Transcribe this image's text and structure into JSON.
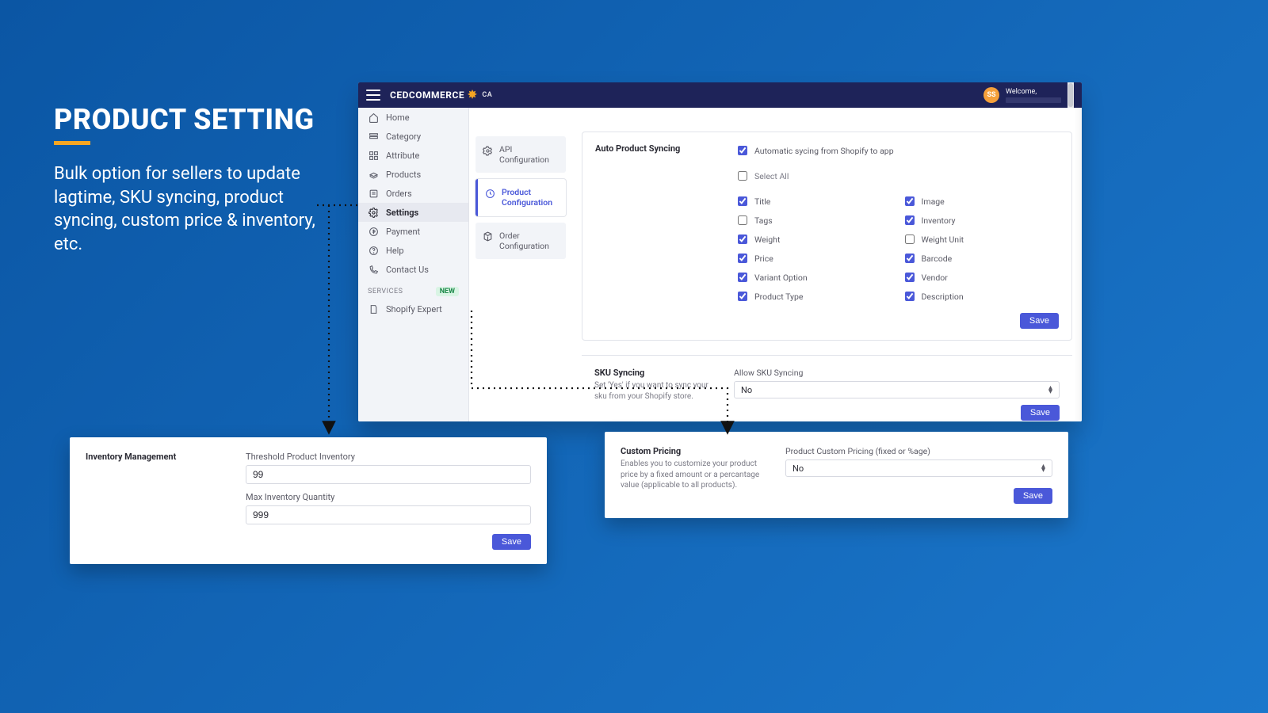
{
  "promo": {
    "title": "PRODUCT SETTING",
    "body": "Bulk option for sellers to update lagtime, SKU syncing, product syncing, custom price & inventory, etc."
  },
  "header": {
    "brand": "CEDCOMMERCE",
    "brand_suffix": "CA",
    "avatar_initials": "SS",
    "welcome": "Welcome,"
  },
  "sidebar": {
    "items": [
      {
        "label": "Home",
        "icon": "home-icon"
      },
      {
        "label": "Category",
        "icon": "category-icon"
      },
      {
        "label": "Attribute",
        "icon": "attribute-icon"
      },
      {
        "label": "Products",
        "icon": "products-icon"
      },
      {
        "label": "Orders",
        "icon": "orders-icon"
      },
      {
        "label": "Settings",
        "icon": "settings-icon",
        "active": true
      },
      {
        "label": "Payment",
        "icon": "payment-icon"
      },
      {
        "label": "Help",
        "icon": "help-icon"
      },
      {
        "label": "Contact Us",
        "icon": "contact-icon"
      }
    ],
    "services_label": "SERVICES",
    "services_badge": "NEW",
    "shopify_expert": "Shopify Expert"
  },
  "subnav": {
    "api": "API Configuration",
    "product": "Product\nConfiguration",
    "order": "Order Configuration"
  },
  "auto_sync": {
    "title": "Auto Product Syncing",
    "auto_label": "Automatic sycing from Shopify to app",
    "select_all_label": "Select All",
    "save": "Save",
    "options": [
      {
        "label": "Title",
        "checked": true
      },
      {
        "label": "Image",
        "checked": true
      },
      {
        "label": "Tags",
        "checked": false
      },
      {
        "label": "Inventory",
        "checked": true
      },
      {
        "label": "Weight",
        "checked": true
      },
      {
        "label": "Weight Unit",
        "checked": false
      },
      {
        "label": "Price",
        "checked": true
      },
      {
        "label": "Barcode",
        "checked": true
      },
      {
        "label": "Variant Option",
        "checked": true
      },
      {
        "label": "Vendor",
        "checked": true
      },
      {
        "label": "Product Type",
        "checked": true
      },
      {
        "label": "Description",
        "checked": true
      }
    ]
  },
  "sku": {
    "title": "SKU Syncing",
    "desc": "Set 'Yes' if you want to sync your sku from your Shopify store.",
    "field_label": "Allow SKU Syncing",
    "value": "No",
    "save": "Save"
  },
  "inventory": {
    "title": "Inventory Management",
    "threshold_label": "Threshold Product Inventory",
    "threshold_value": "99",
    "max_label": "Max Inventory Quantity",
    "max_value": "999",
    "save": "Save"
  },
  "pricing": {
    "title": "Custom Pricing",
    "desc": "Enables you to customize your product price by a fixed amount or a percantage value (applicable to all products).",
    "field_label": "Product Custom Pricing (fixed or %age)",
    "value": "No",
    "save": "Save"
  }
}
